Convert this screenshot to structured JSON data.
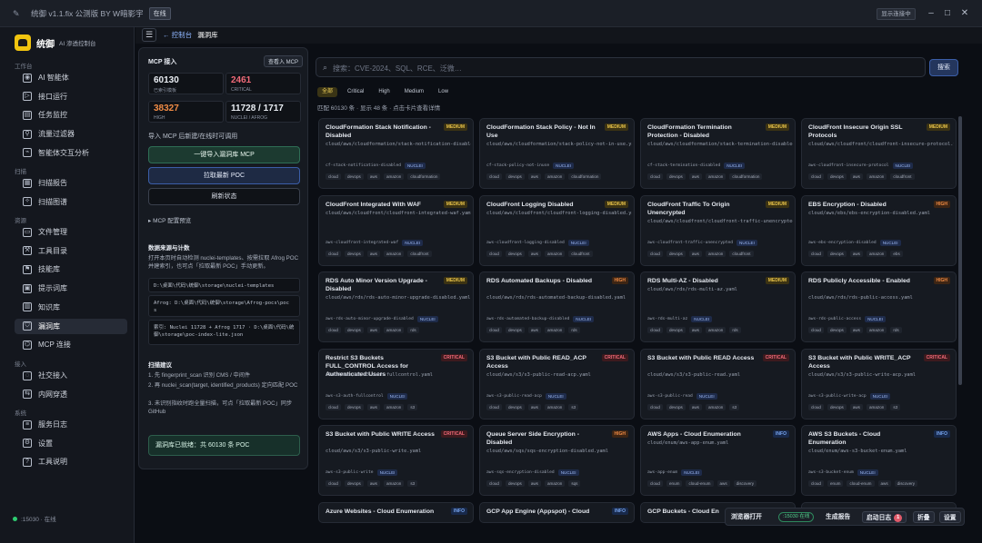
{
  "window": {
    "title": "统御 v1.1.fix 公测版 BY W暗影宇",
    "badge": "在线",
    "show_connection": "显示连接中"
  },
  "brand": {
    "name": "统御",
    "subtitle": "AI 渗透控制台"
  },
  "sidebar": {
    "sections": [
      {
        "label": "工作台",
        "items": [
          {
            "label": "AI 智能体",
            "icon": "robot-icon"
          },
          {
            "label": "接口运行",
            "icon": "play-icon"
          },
          {
            "label": "任务监控",
            "icon": "monitor-icon"
          },
          {
            "label": "流量过滤器",
            "icon": "filter-icon"
          },
          {
            "label": "智能体交互分析",
            "icon": "chart-icon"
          }
        ]
      },
      {
        "label": "扫描",
        "items": [
          {
            "label": "扫描报告",
            "icon": "report-icon"
          },
          {
            "label": "扫描图谱",
            "icon": "graph-icon"
          }
        ]
      },
      {
        "label": "资源",
        "items": [
          {
            "label": "文件管理",
            "icon": "folder-icon"
          },
          {
            "label": "工具目录",
            "icon": "tools-icon"
          },
          {
            "label": "技能库",
            "icon": "skill-icon"
          },
          {
            "label": "提示词库",
            "icon": "prompt-icon"
          },
          {
            "label": "知识库",
            "icon": "book-icon"
          },
          {
            "label": "漏洞库",
            "icon": "shield-icon",
            "active": true
          },
          {
            "label": "MCP 连接",
            "icon": "plug-icon"
          }
        ]
      },
      {
        "label": "接入",
        "items": [
          {
            "label": "社交接入",
            "icon": "chat-icon"
          },
          {
            "label": "内网穿透",
            "icon": "tunnel-icon"
          }
        ]
      },
      {
        "label": "系统",
        "items": [
          {
            "label": "服务日志",
            "icon": "log-icon"
          },
          {
            "label": "设置",
            "icon": "gear-icon"
          },
          {
            "label": "工具说明",
            "icon": "help-icon"
          }
        ]
      }
    ],
    "status": ":15030 · 在线"
  },
  "header": {
    "back": "← 控制台",
    "current": "漏洞库"
  },
  "mcp_panel": {
    "title": "MCP 接入",
    "docs_button": "查看入 MCP",
    "stats": [
      {
        "value": "60130",
        "label": "已索引模板",
        "color": "#e9edf3"
      },
      {
        "value": "2461",
        "label": "CRITICAL",
        "color": "#f06a78"
      },
      {
        "value": "38327",
        "label": "HIGH",
        "color": "#f08b45"
      },
      {
        "value": "11728 / 1717",
        "label": "NUCLEI / AFROG",
        "color": "#e9edf3"
      }
    ],
    "note": "导入 MCP 后新建/在线时可调用",
    "buttons": [
      "一键导入漏洞库 MCP",
      "拉取最新 POC",
      "刷新状态"
    ],
    "fold": "▸  MCP 配置预览",
    "data_section_title": "数据来源与计数",
    "data_section_text": "打开本页时自动检测 nuclei-templates、按需拉取 Afrog POC 并建索引，也可点「拉取最新 POC」手动更新。",
    "paths": [
      "D:\\桌面\\代码\\统御\\storage\\nuclei-templates",
      "Afrog: D:\\桌面\\代码\\统御\\storage\\Afrog-pocs\\poc s",
      "索引: Nuclei 11728 + Afrog 1717 · D:\\桌面\\代码\\统御\\storage\\poc-index-lite.json"
    ],
    "scan_section_title": "扫描建议",
    "scan_steps": [
      "1. 先 fingerprint_scan 识别 CMS / 中间件",
      "2. 再 nuclei_scan(target, identified_products) 定向匹配 POC",
      "3. 未识别指纹时跑全量扫描，可点「拉取最新 POC」同步 GitHub"
    ],
    "ready": "漏洞库已就绪：共 60130 条 POC"
  },
  "search": {
    "placeholder": "搜索：CVE-2024、SQL、RCE、泛微…",
    "button": "搜索"
  },
  "filters": [
    "全部",
    "Critical",
    "High",
    "Medium",
    "Low"
  ],
  "result_info": "匹配 60130 条 · 显示 48 条 · 点击卡片查看详情",
  "cards": [
    {
      "title": "CloudFormation Stack Notification - Disabled",
      "severity": "MEDIUM",
      "path": "cloud/aws/cloudformation/stack-notification-disabled.yaml",
      "id": "cf-stack-notification-disabled",
      "source": "NUCLEI",
      "tags": [
        "cloud",
        "devops",
        "aws",
        "amazon",
        "cloudformation"
      ]
    },
    {
      "title": "CloudFormation Stack Policy - Not In Use",
      "severity": "MEDIUM",
      "path": "cloud/aws/cloudformation/stack-policy-not-in-use.yaml",
      "id": "cf-stack-policy-not-inuse",
      "source": "NUCLEI",
      "tags": [
        "cloud",
        "devops",
        "aws",
        "amazon",
        "cloudformation"
      ]
    },
    {
      "title": "CloudFormation Termination Protection - Disabled",
      "severity": "MEDIUM",
      "path": "cloud/aws/cloudformation/stack-termination-disabled.yaml",
      "id": "cf-stack-termination-disabled",
      "source": "NUCLEI",
      "tags": [
        "cloud",
        "devops",
        "aws",
        "amazon",
        "cloudformation"
      ]
    },
    {
      "title": "CloudFront Insecure Origin SSL Protocols",
      "severity": "MEDIUM",
      "path": "cloud/aws/cloudfront/cloudfront-insecure-protocol.yaml",
      "id": "aws-cloudfront-insecure-protocol",
      "source": "NUCLEI",
      "tags": [
        "cloud",
        "devops",
        "aws",
        "amazon",
        "cloudfront"
      ]
    },
    {
      "title": "CloudFront Integrated With WAF",
      "severity": "MEDIUM",
      "path": "cloud/aws/cloudfront/cloudfront-integrated-waf.yaml",
      "id": "aws-cloudfront-integrated-waf",
      "source": "NUCLEI",
      "tags": [
        "cloud",
        "devops",
        "aws",
        "amazon",
        "cloudfront"
      ]
    },
    {
      "title": "CloudFront Logging Disabled",
      "severity": "MEDIUM",
      "path": "cloud/aws/cloudfront/cloudfront-logging-disabled.yaml",
      "id": "aws-cloudfront-logging-disabled",
      "source": "NUCLEI",
      "tags": [
        "cloud",
        "devops",
        "aws",
        "amazon",
        "cloudfront"
      ]
    },
    {
      "title": "CloudFront Traffic To Origin Unencrypted",
      "severity": "MEDIUM",
      "path": "cloud/aws/cloudfront/cloudfront-traffic-unencrypted.yaml",
      "id": "aws-cloudfront-traffic-unencrypted",
      "source": "NUCLEI",
      "tags": [
        "cloud",
        "devops",
        "aws",
        "amazon",
        "cloudfront"
      ]
    },
    {
      "title": "EBS Encryption - Disabled",
      "severity": "HIGH",
      "path": "cloud/aws/ebs/ebs-encryption-disabled.yaml",
      "id": "aws-ebs-encryption-disabled",
      "source": "NUCLEI",
      "tags": [
        "cloud",
        "devops",
        "aws",
        "amazon",
        "ebs"
      ]
    },
    {
      "title": "RDS Auto Minor Version Upgrade - Disabled",
      "severity": "MEDIUM",
      "path": "cloud/aws/rds/rds-auto-minor-upgrade-disabled.yaml",
      "id": "aws-rds-auto-minor-upgrade-disabled",
      "source": "NUCLEI",
      "tags": [
        "cloud",
        "devops",
        "aws",
        "amazon",
        "rds"
      ]
    },
    {
      "title": "RDS Automated Backups - Disabled",
      "severity": "HIGH",
      "path": "cloud/aws/rds/rds-automated-backup-disabled.yaml",
      "id": "aws-rds-automated-backup-disabled",
      "source": "NUCLEI",
      "tags": [
        "cloud",
        "devops",
        "aws",
        "amazon",
        "rds"
      ]
    },
    {
      "title": "RDS Multi-AZ - Disabled",
      "severity": "MEDIUM",
      "path": "cloud/aws/rds/rds-multi-az.yaml",
      "id": "aws-rds-multi-az",
      "source": "NUCLEI",
      "tags": [
        "cloud",
        "devops",
        "aws",
        "amazon",
        "rds"
      ]
    },
    {
      "title": "RDS Publicly Accessible - Enabled",
      "severity": "HIGH",
      "path": "cloud/aws/rds/rds-public-access.yaml",
      "id": "aws-rds-public-access",
      "source": "NUCLEI",
      "tags": [
        "cloud",
        "devops",
        "aws",
        "amazon",
        "rds"
      ]
    },
    {
      "title": "Restrict S3 Buckets FULL_CONTROL Access for Authenticated Users",
      "severity": "CRITICAL",
      "path": "cloud/aws/s3/s3-auth-fullcontrol.yaml",
      "id": "aws-s3-auth-fullcontrol",
      "source": "NUCLEI",
      "tags": [
        "cloud",
        "devops",
        "aws",
        "amazon",
        "s3"
      ]
    },
    {
      "title": "S3 Bucket with Public READ_ACP Access",
      "severity": "CRITICAL",
      "path": "cloud/aws/s3/s3-public-read-acp.yaml",
      "id": "aws-s3-public-read-acp",
      "source": "NUCLEI",
      "tags": [
        "cloud",
        "devops",
        "aws",
        "amazon",
        "s3"
      ]
    },
    {
      "title": "S3 Bucket with Public READ Access",
      "severity": "CRITICAL",
      "path": "cloud/aws/s3/s3-public-read.yaml",
      "id": "aws-s3-public-read",
      "source": "NUCLEI",
      "tags": [
        "cloud",
        "devops",
        "aws",
        "amazon",
        "s3"
      ]
    },
    {
      "title": "S3 Bucket with Public WRITE_ACP Access",
      "severity": "CRITICAL",
      "path": "cloud/aws/s3/s3-public-write-acp.yaml",
      "id": "aws-s3-public-write-acp",
      "source": "NUCLEI",
      "tags": [
        "cloud",
        "devops",
        "aws",
        "amazon",
        "s3"
      ]
    },
    {
      "title": "S3 Bucket with Public WRITE Access",
      "severity": "CRITICAL",
      "path": "cloud/aws/s3/s3-public-write.yaml",
      "id": "aws-s3-public-write",
      "source": "NUCLEI",
      "tags": [
        "cloud",
        "devops",
        "aws",
        "amazon",
        "s3"
      ]
    },
    {
      "title": "Queue Server Side Encryption - Disabled",
      "severity": "HIGH",
      "path": "cloud/aws/sqs/sqs-encryption-disabled.yaml",
      "id": "aws-sqs-encryption-disabled",
      "source": "NUCLEI",
      "tags": [
        "cloud",
        "devops",
        "aws",
        "amazon",
        "sqs"
      ]
    },
    {
      "title": "AWS Apps - Cloud Enumeration",
      "severity": "INFO",
      "path": "cloud/enum/aws-app-enum.yaml",
      "id": "aws-app-enum",
      "source": "NUCLEI",
      "tags": [
        "cloud",
        "enum",
        "cloud-enum",
        "aws",
        "discovery"
      ]
    },
    {
      "title": "AWS S3 Buckets - Cloud Enumeration",
      "severity": "INFO",
      "path": "cloud/enum/aws-s3-bucket-enum.yaml",
      "id": "aws-s3-bucket-enum",
      "source": "NUCLEI",
      "tags": [
        "cloud",
        "enum",
        "cloud-enum",
        "aws",
        "discovery"
      ]
    },
    {
      "title": "Azure Websites - Cloud Enumeration",
      "severity": "INFO",
      "path": "",
      "id": "",
      "source": "",
      "tags": []
    },
    {
      "title": "GCP App Engine (Appspot) - Cloud",
      "severity": "INFO",
      "path": "",
      "id": "",
      "source": "",
      "tags": []
    },
    {
      "title": "GCP Buckets - Cloud En",
      "severity": "INFO",
      "path": "",
      "id": "",
      "source": "",
      "tags": []
    },
    {
      "title": "",
      "severity": "",
      "path": "",
      "id": "",
      "source": "",
      "tags": []
    }
  ],
  "float_bar": {
    "browser": "浏览器打开",
    "badge": ":15030 在线",
    "report": "生成报告",
    "startup_log": "启动日志",
    "startup_count": "1",
    "collapse": "折叠",
    "settings": "设置"
  }
}
